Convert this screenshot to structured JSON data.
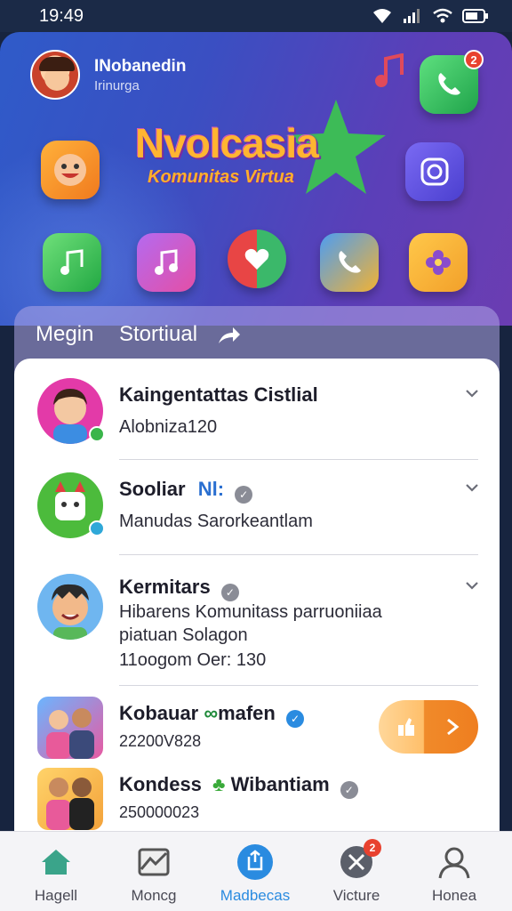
{
  "status_bar": {
    "time": "19:49"
  },
  "hero": {
    "user_name": "INobanedin",
    "user_sub": "Irinurga",
    "title": "Nvolcasia",
    "subtitle": "Komunitas Virtua",
    "notification_count": "2"
  },
  "tabs": {
    "first": "Megin",
    "second": "Stortiual"
  },
  "list": [
    {
      "title": "Kaingentattas Cistlial",
      "line1": "Alobniza120"
    },
    {
      "title": "Sooliar",
      "highlight": "Nl:",
      "line1": "Manudas Sarorkeantlam"
    },
    {
      "title": "Kermitars",
      "line1": "Hibarens Komunitass parruoniiaa",
      "line2": "piatuan Solagon",
      "line3": "11oogom Oer: 130"
    },
    {
      "title": "Kobauar",
      "highlight": "mafen",
      "line1": "22200V828"
    },
    {
      "title": "Kondess",
      "highlight": "Wibantiam",
      "line1": "250000023"
    }
  ],
  "bottom_nav": [
    {
      "label": "Hagell"
    },
    {
      "label": "Moncg"
    },
    {
      "label": "Madbecas"
    },
    {
      "label": "Victure",
      "badge": "2"
    },
    {
      "label": "Honea"
    }
  ],
  "colors": {
    "accent": "#2a8be0",
    "hero_start": "#2f5bc9",
    "hero_end": "#6b3db2",
    "badge": "#e8412f",
    "cta": "#ef7e1f"
  }
}
